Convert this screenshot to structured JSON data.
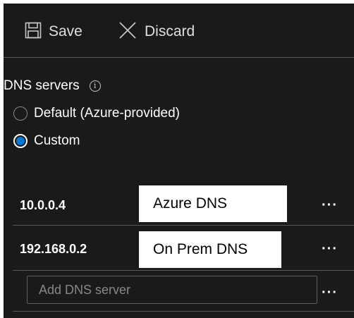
{
  "toolbar": {
    "save_label": "Save",
    "save_icon": "save-icon",
    "discard_label": "Discard",
    "discard_icon": "close-icon"
  },
  "dns": {
    "section_label": "DNS servers",
    "info_icon": "info-icon",
    "info_glyph": "i",
    "options": [
      {
        "label": "Default (Azure-provided)",
        "selected": false
      },
      {
        "label": "Custom",
        "selected": true
      }
    ],
    "servers": [
      {
        "ip": "10.0.0.4",
        "name": "Azure DNS"
      },
      {
        "ip": "192.168.0.2",
        "name": "On Prem DNS"
      }
    ],
    "more_label": "···",
    "add_placeholder": "Add DNS server",
    "add_value": ""
  },
  "colors": {
    "background": "#1b1a19",
    "accent": "#0078d4",
    "divider": "#5a5856"
  }
}
